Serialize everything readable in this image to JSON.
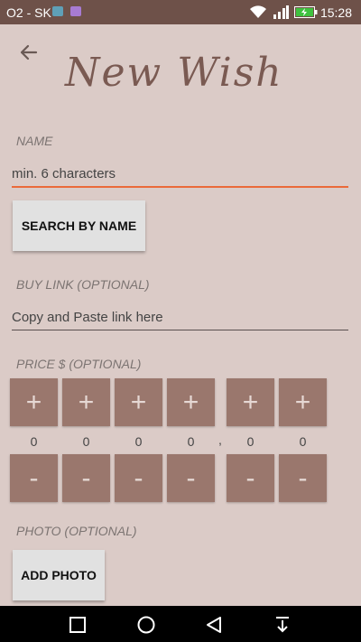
{
  "status_bar": {
    "carrier": "O2 - SK",
    "time": "15:28"
  },
  "header": {
    "title": "New Wish"
  },
  "name_section": {
    "label": "NAME",
    "placeholder": "min. 6 characters",
    "search_button": "SEARCH BY NAME"
  },
  "link_section": {
    "label": "BUY LINK (OPTIONAL)",
    "placeholder": "Copy and Paste link here"
  },
  "price_section": {
    "label": "PRICE $ (OPTIONAL)",
    "plus_label": "+",
    "minus_label": "-",
    "decimal_separator": ",",
    "digits": [
      "0",
      "0",
      "0",
      "0",
      "0",
      "0"
    ]
  },
  "photo_section": {
    "label": "PHOTO (OPTIONAL)",
    "add_button": "ADD PHOTO"
  },
  "colors": {
    "background": "#dbcbc7",
    "status_bar": "#6e5149",
    "accent_underline": "#ea6a3a",
    "price_buttons": "#9a776d",
    "title": "#7a5a52"
  }
}
